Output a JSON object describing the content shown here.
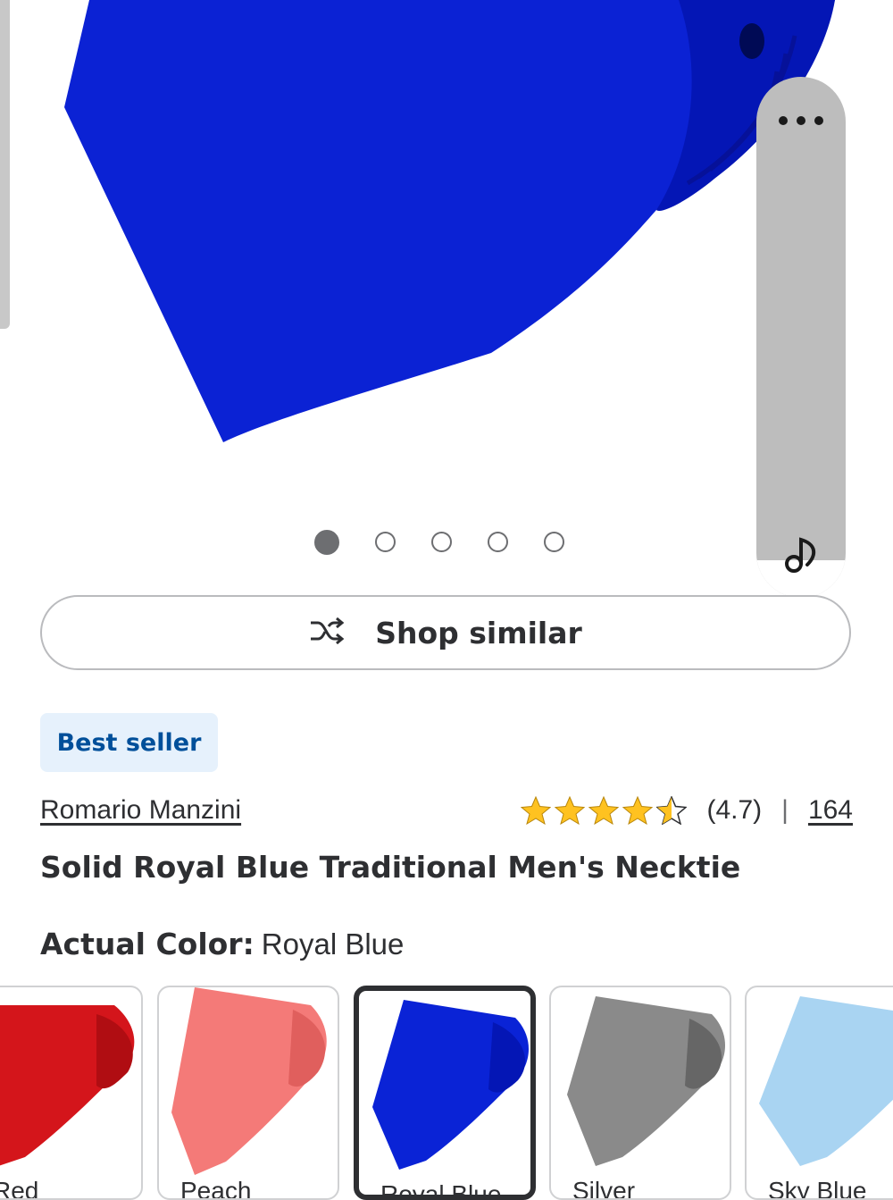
{
  "gallery": {
    "total_images": 5,
    "active_index": 0,
    "image_color": "#0a23d6"
  },
  "actions": {
    "more_icon": "ellipsis-icon",
    "music_icon": "music-note-icon"
  },
  "shop_similar": {
    "label": "Shop similar",
    "icon": "shuffle-icon"
  },
  "badge": {
    "label": "Best seller"
  },
  "product": {
    "brand": "Romario Manzini",
    "rating_text": "(4.7)",
    "rating_value": 4.7,
    "rating_separator": "|",
    "review_count": "164",
    "title": "Solid Royal Blue Traditional Men's Necktie"
  },
  "color_selector": {
    "label": "Actual Color:",
    "selected": "Royal Blue",
    "options": [
      {
        "name": "Red",
        "color": "#d4151b",
        "selected": false
      },
      {
        "name": "Peach",
        "color": "#f47a78",
        "selected": false
      },
      {
        "name": "Royal Blue",
        "color": "#0a23d6",
        "selected": true
      },
      {
        "name": "Silver",
        "color": "#8a8a8a",
        "selected": false
      },
      {
        "name": "Sky Blue",
        "color": "#a9d4f2",
        "selected": false
      }
    ]
  }
}
